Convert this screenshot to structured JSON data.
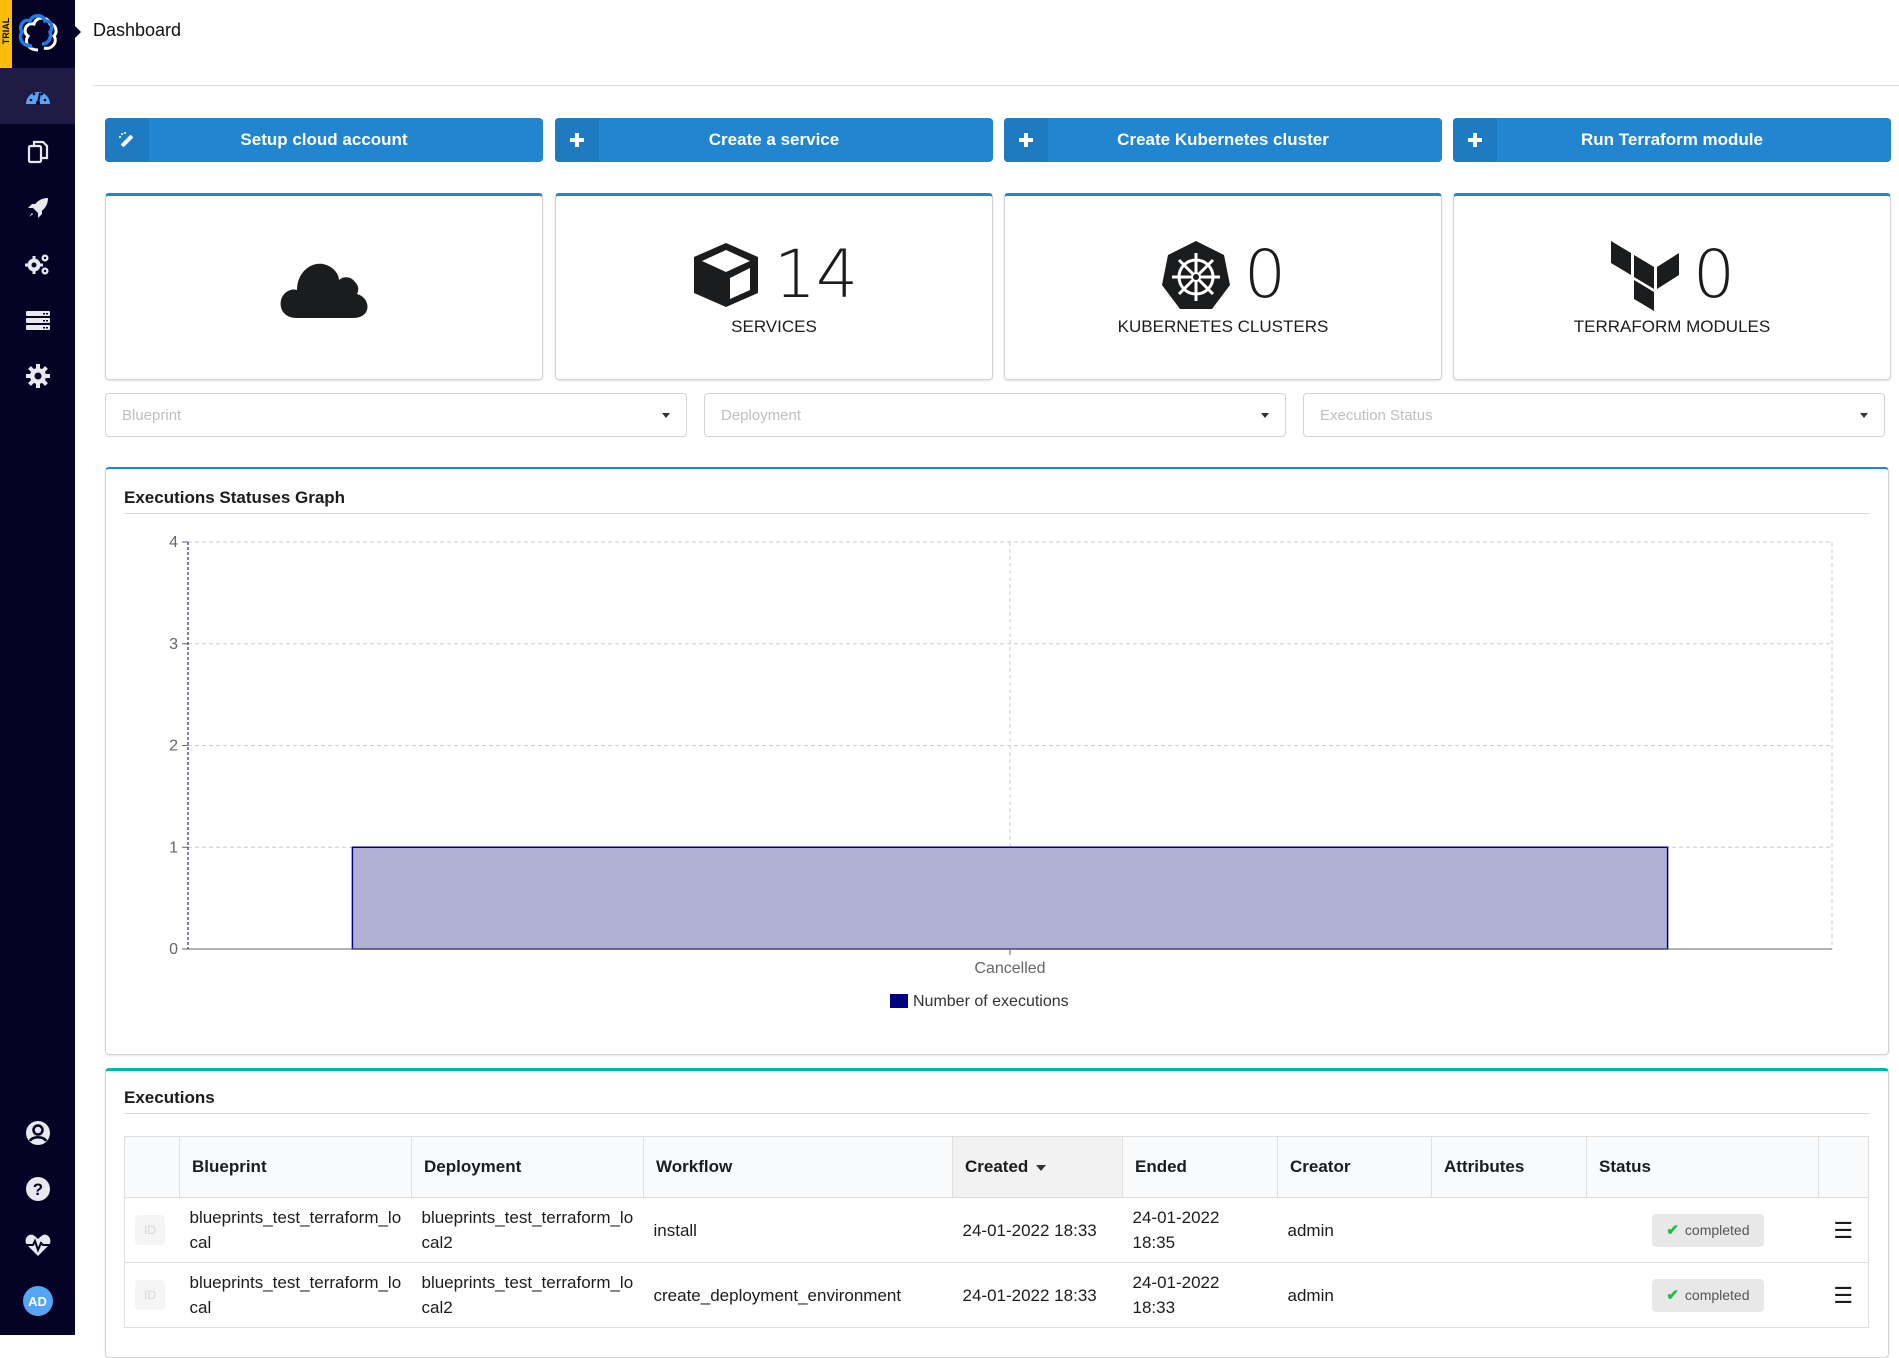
{
  "app": {
    "trial_badge": "TRIAL",
    "page_title": "Dashboard"
  },
  "sidebar": {
    "items": [
      {
        "name": "dashboard",
        "icon": "dashboard-icon",
        "active": true
      },
      {
        "name": "blueprints",
        "icon": "copy-icon",
        "active": false
      },
      {
        "name": "deployments",
        "icon": "rocket-icon",
        "active": false
      },
      {
        "name": "services",
        "icon": "cogs-icon",
        "active": false
      },
      {
        "name": "resources",
        "icon": "server-icon",
        "active": false
      },
      {
        "name": "settings",
        "icon": "gear-icon",
        "active": false
      }
    ],
    "bottom_items": [
      {
        "name": "user",
        "icon": "user-circle-icon"
      },
      {
        "name": "help",
        "icon": "question-circle-icon"
      },
      {
        "name": "health",
        "icon": "heartbeat-icon"
      }
    ],
    "avatar_initials": "AD"
  },
  "actions": [
    {
      "label": "Setup cloud account",
      "icon": "magic-wand-icon"
    },
    {
      "label": "Create a service",
      "icon": "plus-icon"
    },
    {
      "label": "Create Kubernetes cluster",
      "icon": "plus-icon"
    },
    {
      "label": "Run Terraform module",
      "icon": "plus-icon"
    }
  ],
  "cards": [
    {
      "icon": "cloud-icon",
      "value": "",
      "label": ""
    },
    {
      "icon": "cube-icon",
      "value": "14",
      "label": "SERVICES"
    },
    {
      "icon": "kubernetes-icon",
      "value": "0",
      "label": "KUBERNETES CLUSTERS"
    },
    {
      "icon": "terraform-icon",
      "value": "0",
      "label": "TERRAFORM MODULES"
    }
  ],
  "filters": {
    "blueprint_placeholder": "Blueprint",
    "deployment_placeholder": "Deployment",
    "execution_status_placeholder": "Execution Status"
  },
  "chart_panel": {
    "title": "Executions Statuses Graph"
  },
  "chart_data": {
    "type": "bar",
    "title": "Executions Statuses Graph",
    "categories": [
      "Cancelled"
    ],
    "series": [
      {
        "name": "Number of executions",
        "values": [
          1
        ],
        "color": "#000080"
      }
    ],
    "xlabel": "",
    "ylabel": "",
    "ylim": [
      0,
      4
    ],
    "yticks": [
      0,
      1,
      2,
      3,
      4
    ],
    "grid": true,
    "legend": "bottom-center"
  },
  "executions": {
    "title": "Executions",
    "columns": [
      "",
      "Blueprint",
      "Deployment",
      "Workflow",
      "Created",
      "Ended",
      "Creator",
      "Attributes",
      "Status",
      ""
    ],
    "sorted_column": "Created",
    "rows": [
      {
        "id": "ID",
        "blueprint": "blueprints_test_terraform_local",
        "deployment": "blueprints_test_terraform_local2",
        "workflow": "install",
        "created": "24-01-2022 18:33",
        "ended": "24-01-2022 18:35",
        "creator": "admin",
        "attributes": "",
        "status": "completed"
      },
      {
        "id": "ID",
        "blueprint": "blueprints_test_terraform_local",
        "deployment": "blueprints_test_terraform_local2",
        "workflow": "create_deployment_environment",
        "created": "24-01-2022 18:33",
        "ended": "24-01-2022 18:33",
        "creator": "admin",
        "attributes": "",
        "status": "completed"
      }
    ]
  },
  "colors": {
    "sidebar_bg": "#050325",
    "primary": "#2185d0",
    "teal": "#00b5ad",
    "trial": "#fbbd08",
    "bar_fill": "#b0b0d4",
    "bar_stroke": "#000080",
    "success": "#21ba45"
  }
}
